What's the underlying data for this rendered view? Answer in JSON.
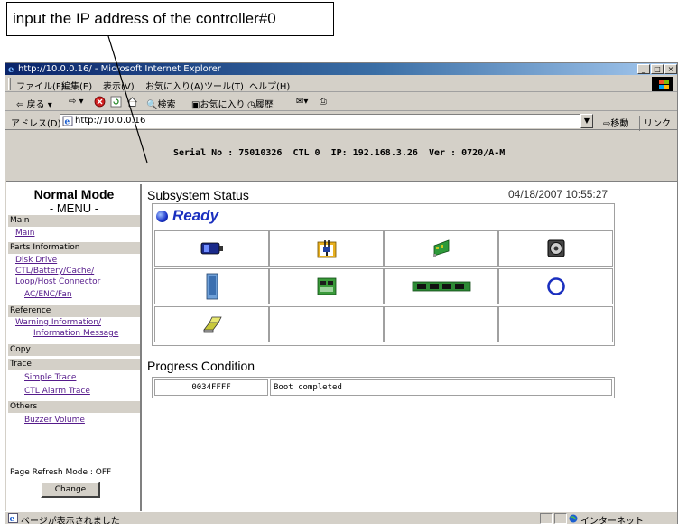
{
  "callout": {
    "text": "input the IP address of the controller#0"
  },
  "window": {
    "title": "http://10.0.0.16/ - Microsoft Internet Explorer",
    "controls": [
      "_",
      "□",
      "×"
    ]
  },
  "menubar": {
    "items": [
      "ファイル(F)",
      "編集(E)",
      "表示(V)",
      "お気に入り(A)",
      "ツール(T)",
      "ヘルプ(H)"
    ]
  },
  "toolbar": {
    "back": "戻る",
    "search": "検索",
    "favorites": "お気に入り",
    "history": "履歴"
  },
  "addressbar": {
    "label": "アドレス(D)",
    "url": "http://10.0.0.16",
    "go": "移動",
    "links": "リンク »"
  },
  "header": {
    "serial_line": "Serial No : 75010326  CTL 0  IP: 192.168.3.26  Ver : 0720/A-M"
  },
  "menu": {
    "mode": "Normal Mode",
    "menu_label": "- MENU -",
    "sections": {
      "main": {
        "label": "Main",
        "links": [
          "Main"
        ]
      },
      "parts": {
        "label": "Parts Information",
        "links": [
          "Disk Drive",
          "CTL/Battery/Cache/",
          "Loop/Host Connector",
          "AC/ENC/Fan"
        ]
      },
      "reference": {
        "label": "Reference",
        "links": [
          "Warning Information/",
          "Information Message"
        ]
      },
      "copy": {
        "label": "Copy"
      },
      "trace": {
        "label": "Trace",
        "links": [
          "Simple Trace",
          "CTL Alarm Trace"
        ]
      },
      "others": {
        "label": "Others",
        "links": [
          "Buzzer Volume"
        ]
      }
    },
    "refresh_mode": "Page Refresh Mode : OFF",
    "change_button": "Change"
  },
  "subsystem": {
    "title": "Subsystem Status",
    "datetime": "04/18/2007 10:55:27",
    "status": "Ready",
    "icons": [
      "battery-icon",
      "power-plug-icon",
      "network-card-icon",
      "fan-icon",
      "disk-drive-icon",
      "circuit-board-icon",
      "memory-module-icon",
      "loop-ring-icon",
      "host-connector-icon"
    ]
  },
  "progress": {
    "title": "Progress Condition",
    "rows": [
      {
        "code": "0034FFFF",
        "message": "Boot completed"
      }
    ]
  },
  "statusbar": {
    "text": "ページが表示されました",
    "zone": "インターネット"
  },
  "colors": {
    "accent": "#1a2fbf",
    "link": "#551a8b",
    "chrome": "#d4d0c8",
    "title_start": "#0a246a"
  }
}
